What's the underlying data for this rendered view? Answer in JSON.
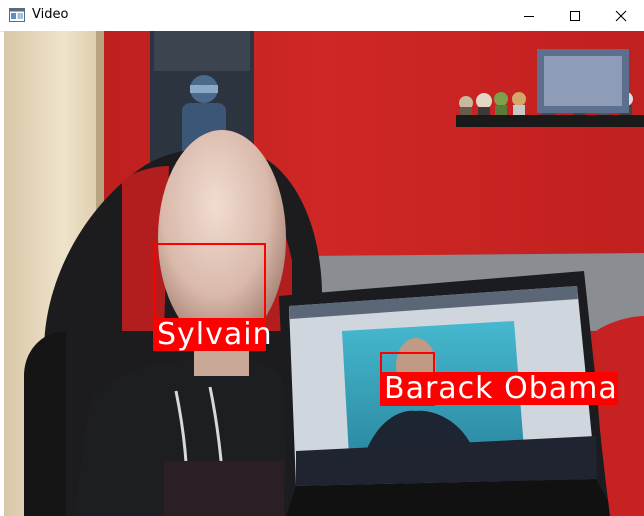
{
  "window": {
    "title": "Video",
    "icon": "app-window-icon",
    "controls": [
      "minimize-icon",
      "maximize-icon",
      "close-icon"
    ]
  },
  "detections": [
    {
      "name": "Sylvain"
    },
    {
      "name": "Barack Obama"
    }
  ],
  "colors": {
    "box": "#ff0000",
    "label_text": "#ffffff",
    "wall": "#c8211f",
    "door": "#e8d9bf"
  }
}
